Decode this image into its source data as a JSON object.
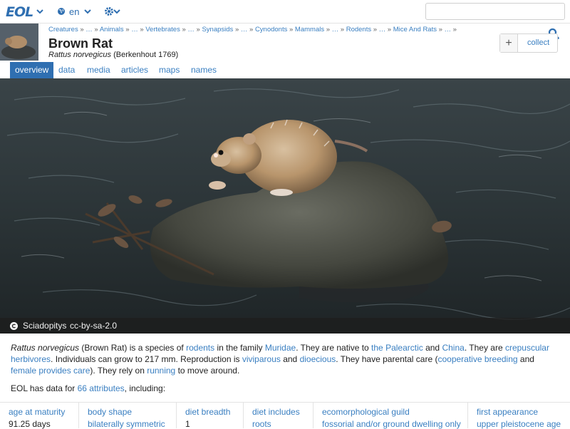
{
  "nav": {
    "logo": "EOL",
    "language": "en"
  },
  "header": {
    "breadcrumb": [
      "Creatures",
      "…",
      "Animals",
      "…",
      "Vertebrates",
      "…",
      "Synapsids",
      "…",
      "Cynodonts",
      "Mammals",
      "…",
      "Rodents",
      "…",
      "Mice And Rats",
      "…"
    ],
    "title": "Brown Rat",
    "scientific_name": "Rattus norvegicus",
    "authority": "(Berkenhout 1769)",
    "collect_label": "collect",
    "collect_plus": "+"
  },
  "tabs": [
    {
      "label": "overview",
      "active": true
    },
    {
      "label": "data",
      "active": false
    },
    {
      "label": "media",
      "active": false
    },
    {
      "label": "articles",
      "active": false
    },
    {
      "label": "maps",
      "active": false
    },
    {
      "label": "names",
      "active": false
    }
  ],
  "hero": {
    "author": "Sciadopitys",
    "license": "cc-by-sa-2.0"
  },
  "summary": {
    "sci": "Rattus norvegicus",
    "t1": " (Brown Rat) is a species of ",
    "l_rodents": "rodents",
    "t2": " in the family ",
    "l_muridae": "Muridae",
    "t3": ". They are native to ",
    "l_palearctic": "the Palearctic",
    "t4": " and ",
    "l_china": "China",
    "t5": ". They are ",
    "l_crepuscular": "crepuscular",
    "t6": " ",
    "l_herbivores": "herbivores",
    "t7": ". Individuals can grow to 217 mm. Reproduction is ",
    "l_viviparous": "viviparous",
    "t8": " and ",
    "l_dioecious": "dioecious",
    "t9": ". They have parental care (",
    "l_coop": "cooperative breeding",
    "t10": " and ",
    "l_female": "female provides care",
    "t11": "). They rely on ",
    "l_running": "running",
    "t12": " to move around."
  },
  "data_count": {
    "prefix": "EOL has data for ",
    "link": "66 attributes",
    "suffix": ", including:"
  },
  "attributes": [
    {
      "key": "age at maturity",
      "value": "91.25 days",
      "value_is_link": false
    },
    {
      "key": "body shape",
      "value": "bilaterally symmetric",
      "value_is_link": true
    },
    {
      "key": "diet breadth",
      "value": "1",
      "value_is_link": false
    },
    {
      "key": "diet includes",
      "value": "roots",
      "value_is_link": true
    },
    {
      "key": "ecomorphological guild",
      "value": "fossorial and/or ground dwelling only",
      "value_is_link": true
    },
    {
      "key": "first appearance",
      "value": "upper pleistocene age",
      "value_is_link": true
    }
  ]
}
